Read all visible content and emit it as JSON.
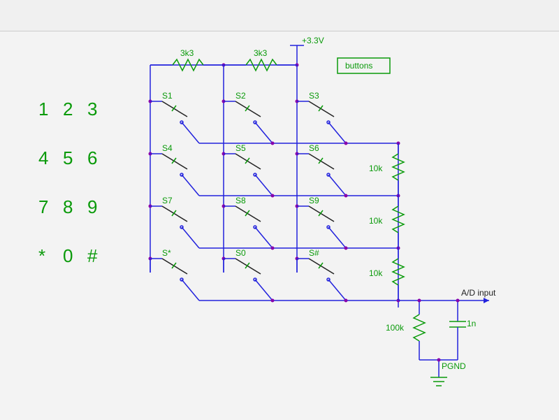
{
  "supply": "+3.3V",
  "box_label": "buttons",
  "resistors_top": [
    "3k3",
    "3k3"
  ],
  "switches": [
    [
      "S1",
      "S2",
      "S3"
    ],
    [
      "S4",
      "S5",
      "S6"
    ],
    [
      "S7",
      "S8",
      "S9"
    ],
    [
      "S*",
      "S0",
      "S#"
    ]
  ],
  "resistors_right": [
    "10k",
    "10k",
    "10k"
  ],
  "bottom": {
    "r": "100k",
    "c": "1n",
    "gnd": "PGND",
    "out": "A/D input"
  },
  "keypad": [
    [
      "1",
      "2",
      "3"
    ],
    [
      "4",
      "5",
      "6"
    ],
    [
      "7",
      "8",
      "9"
    ],
    [
      "*",
      "0",
      "#"
    ]
  ]
}
